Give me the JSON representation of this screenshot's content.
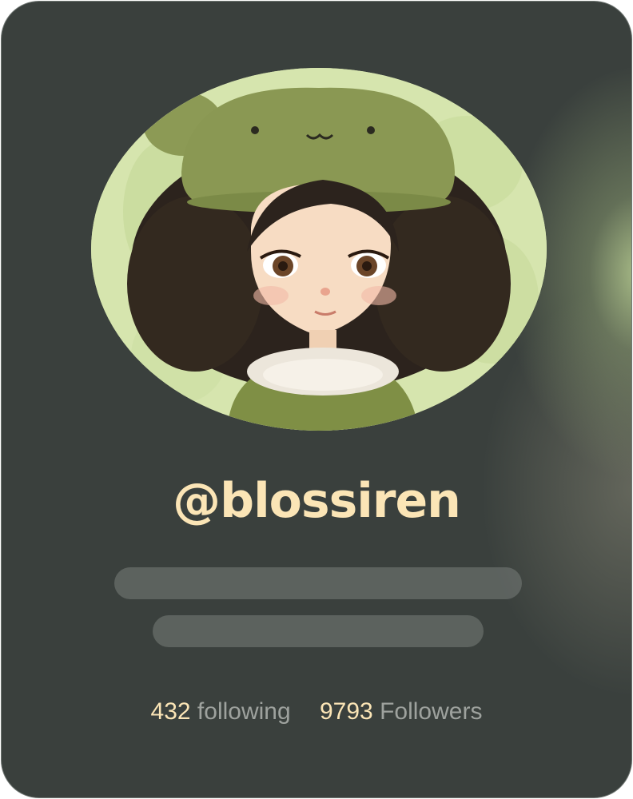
{
  "profile": {
    "username": "@blossiren",
    "following_count": "432",
    "following_label": "following",
    "followers_count": "9793",
    "followers_label": "Followers"
  },
  "colors": {
    "card_background": "#3a403d",
    "accent_text": "#fbe5b6",
    "muted_text": "#9ea29e",
    "placeholder_bar": "#5e6461",
    "avatar_background": "#d8e6b2"
  },
  "icons": {
    "avatar": "avatar-illustration"
  }
}
